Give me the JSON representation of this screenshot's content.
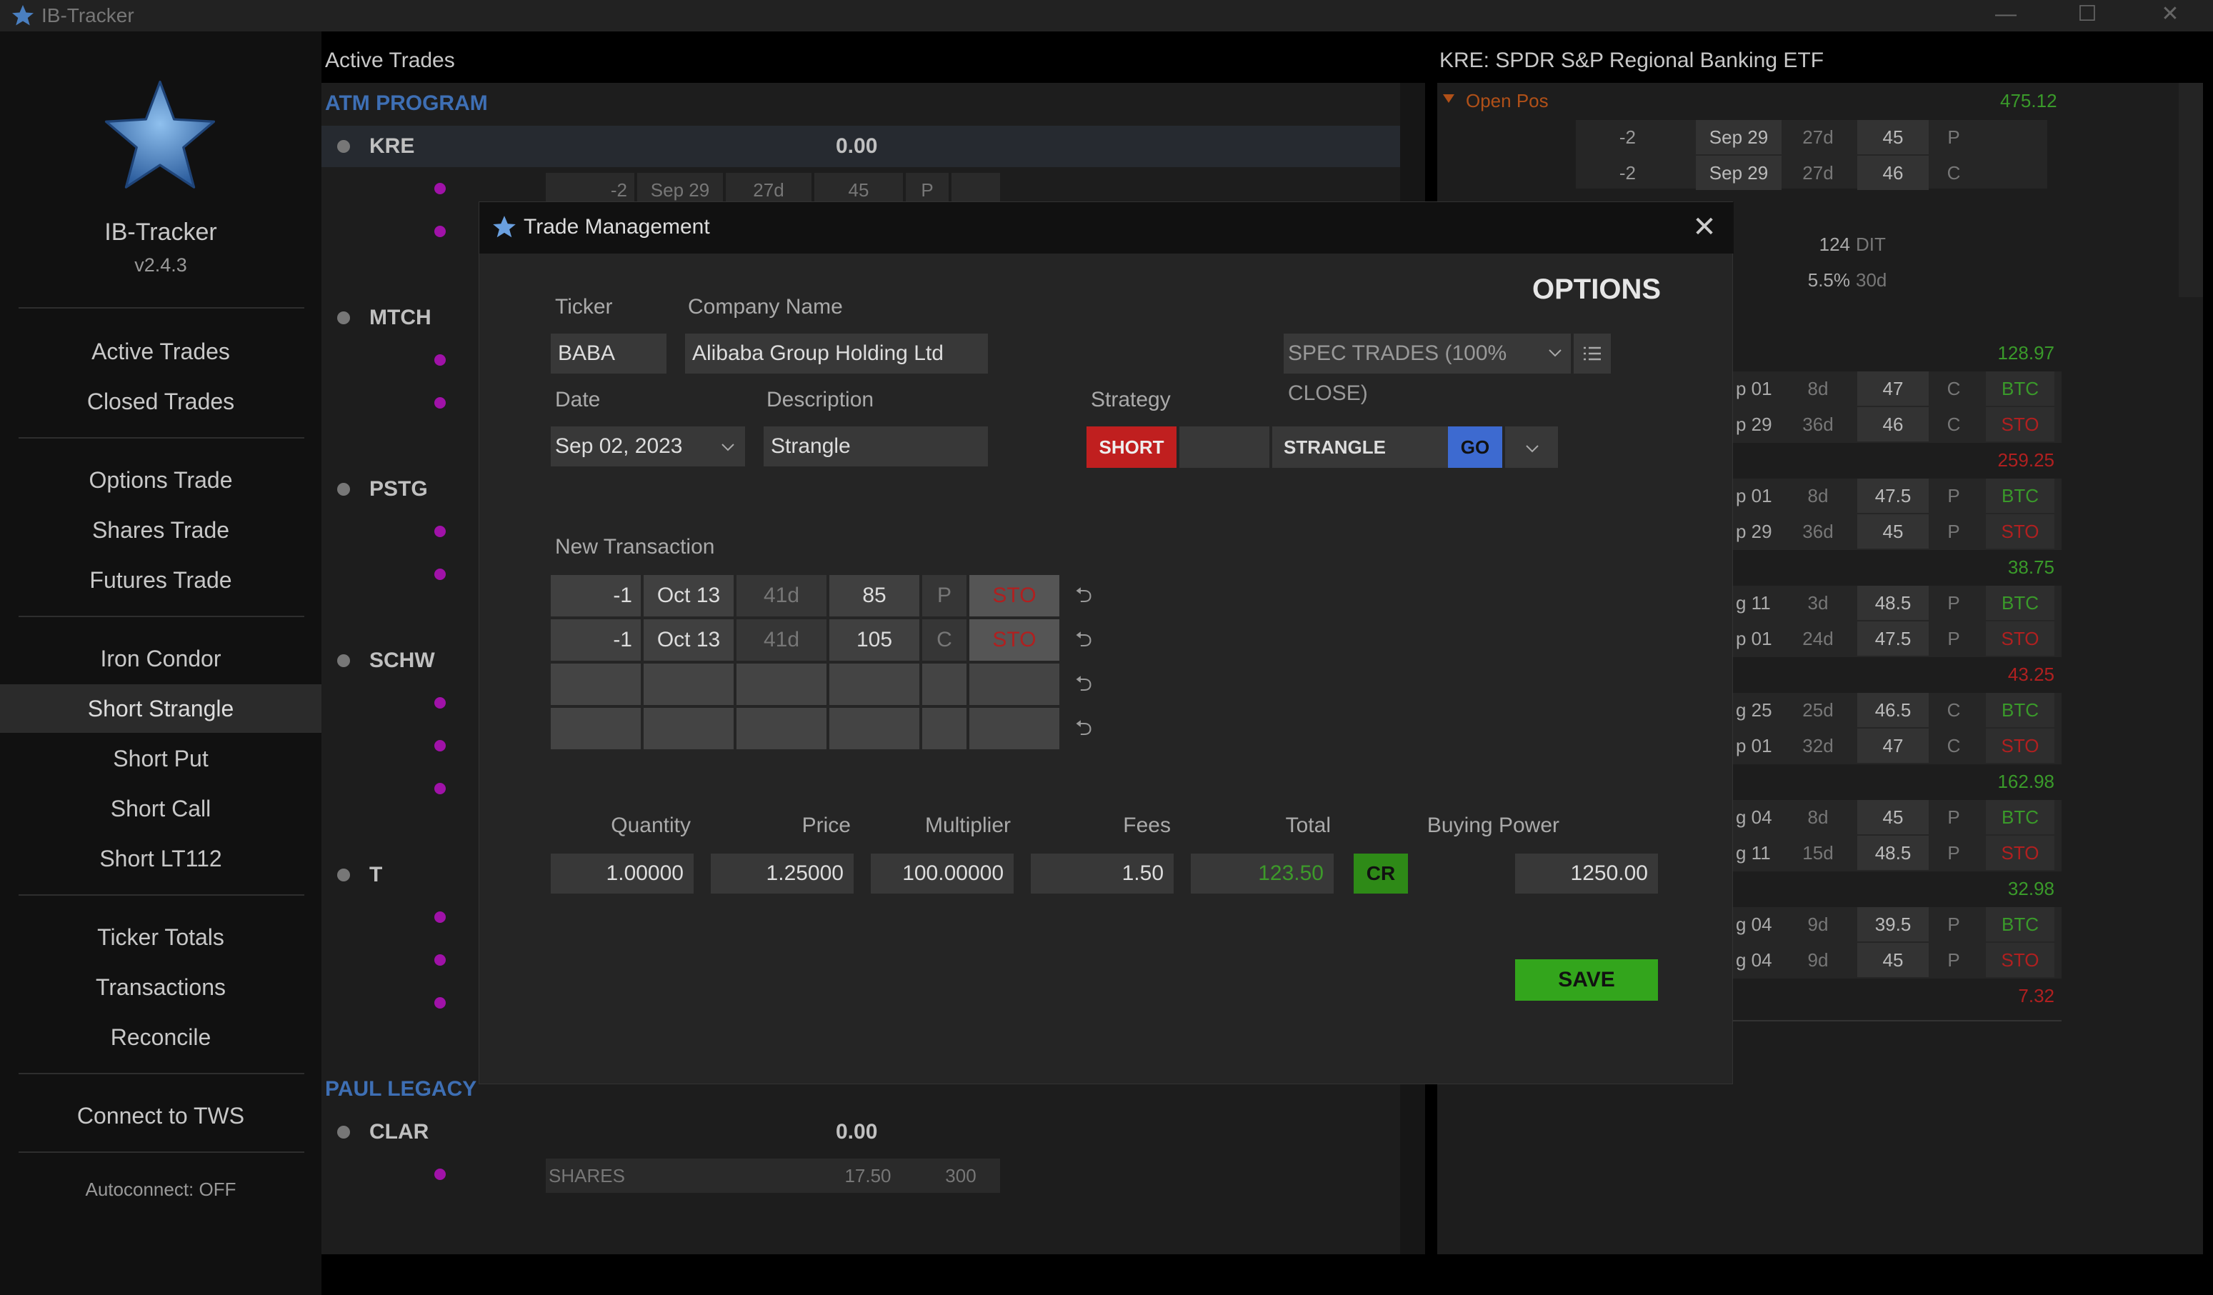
{
  "window": {
    "title": "IB-Tracker",
    "min": "—",
    "max": "☐",
    "close": "✕"
  },
  "sidebar": {
    "app_name": "IB-Tracker",
    "version": "v2.4.3",
    "items": [
      "Active Trades",
      "Closed Trades",
      "Options Trade",
      "Shares Trade",
      "Futures Trade",
      "Iron Condor",
      "Short Strangle",
      "Short Put",
      "Short Call",
      "Short LT112",
      "Ticker Totals",
      "Transactions",
      "Reconcile",
      "Connect to TWS"
    ],
    "selected": "Short Strangle",
    "autoconnect": "Autoconnect: OFF"
  },
  "center": {
    "header": "Active Trades",
    "cat1": "ATM PROGRAM",
    "cat2": "PAUL LEGACY",
    "tickers": {
      "kre": "KRE",
      "mtch": "MTCH",
      "pstg": "PSTG",
      "schw": "SCHW",
      "t": "T",
      "clar": "CLAR"
    },
    "kre_total": "0.00",
    "kre_leg": {
      "qty": "-2",
      "exp": "Sep 29",
      "dte": "27d",
      "strike": "45",
      "pc": "P"
    },
    "clar_total": "0.00",
    "clar_leg": {
      "type": "SHARES",
      "price": "17.50",
      "qty": "300"
    }
  },
  "right": {
    "header": "KRE: SPDR S&P Regional Banking ETF",
    "open_pos": "Open Pos",
    "open_total": "475.12",
    "open_legs": [
      {
        "qty": "-2",
        "exp": "Sep 29",
        "dte": "27d",
        "strike": "45",
        "pc": "P"
      },
      {
        "qty": "-2",
        "exp": "Sep 29",
        "dte": "27d",
        "strike": "46",
        "pc": "C"
      }
    ],
    "dit": "124",
    "dit_label": "DIT",
    "pct": "5.5%",
    "pct_label": "30d",
    "groups": [
      {
        "total": "128.97",
        "total_color": "green",
        "legs": [
          {
            "exp": "p 01",
            "dte": "8d",
            "strike": "47",
            "pc": "C",
            "act": "BTC"
          },
          {
            "exp": "p 29",
            "dte": "36d",
            "strike": "46",
            "pc": "C",
            "act": "STO"
          }
        ]
      },
      {
        "total": "259.25",
        "total_color": "red",
        "legs": [
          {
            "exp": "p 01",
            "dte": "8d",
            "strike": "47.5",
            "pc": "P",
            "act": "BTC"
          },
          {
            "exp": "p 29",
            "dte": "36d",
            "strike": "45",
            "pc": "P",
            "act": "STO"
          }
        ]
      },
      {
        "total": "38.75",
        "total_color": "green",
        "legs": [
          {
            "exp": "g 11",
            "dte": "3d",
            "strike": "48.5",
            "pc": "P",
            "act": "BTC"
          },
          {
            "exp": "p 01",
            "dte": "24d",
            "strike": "47.5",
            "pc": "P",
            "act": "STO"
          }
        ]
      },
      {
        "total": "43.25",
        "total_color": "red",
        "legs": [
          {
            "exp": "g 25",
            "dte": "25d",
            "strike": "46.5",
            "pc": "C",
            "act": "BTC"
          },
          {
            "exp": "p 01",
            "dte": "32d",
            "strike": "47",
            "pc": "C",
            "act": "STO"
          }
        ]
      },
      {
        "total": "162.98",
        "total_color": "green",
        "legs": [
          {
            "exp": "g 04",
            "dte": "8d",
            "strike": "45",
            "pc": "P",
            "act": "BTC"
          },
          {
            "exp": "g 11",
            "dte": "15d",
            "strike": "48.5",
            "pc": "P",
            "act": "STO"
          }
        ]
      },
      {
        "total": "32.98",
        "total_color": "green",
        "legs": [
          {
            "exp": "g 04",
            "dte": "9d",
            "strike": "39.5",
            "pc": "P",
            "act": "BTC"
          },
          {
            "exp": "g 04",
            "dte": "9d",
            "strike": "45",
            "pc": "P",
            "act": "STO"
          }
        ]
      },
      {
        "total": "7.32",
        "total_color": "red",
        "legs": []
      }
    ]
  },
  "modal": {
    "title": "Trade Management",
    "close": "✕",
    "heading": "OPTIONS",
    "ticker_label": "Ticker",
    "ticker": "BABA",
    "company_label": "Company Name",
    "company": "Alibaba Group Holding Ltd",
    "category": "SPEC TRADES (100% CLOSE)",
    "date_label": "Date",
    "date": "Sep 02, 2023",
    "desc_label": "Description",
    "desc": "Strangle",
    "strategy_label": "Strategy",
    "short_btn": "SHORT",
    "strategy": "STRANGLE",
    "go_btn": "GO",
    "newtx_label": "New Transaction",
    "legs": [
      {
        "qty": "-1",
        "exp": "Oct 13",
        "dte": "41d",
        "strike": "85",
        "pc": "P",
        "act": "STO"
      },
      {
        "qty": "-1",
        "exp": "Oct 13",
        "dte": "41d",
        "strike": "105",
        "pc": "C",
        "act": "STO"
      }
    ],
    "undo_glyph": "⮌",
    "headers": {
      "quantity": "Quantity",
      "price": "Price",
      "multiplier": "Multiplier",
      "fees": "Fees",
      "total": "Total",
      "bp": "Buying Power"
    },
    "quantity": "1.00000",
    "price": "1.25000",
    "multiplier": "100.00000",
    "fees": "1.50",
    "total": "123.50",
    "cr_btn": "CR",
    "bp": "1250.00",
    "save_btn": "SAVE"
  }
}
